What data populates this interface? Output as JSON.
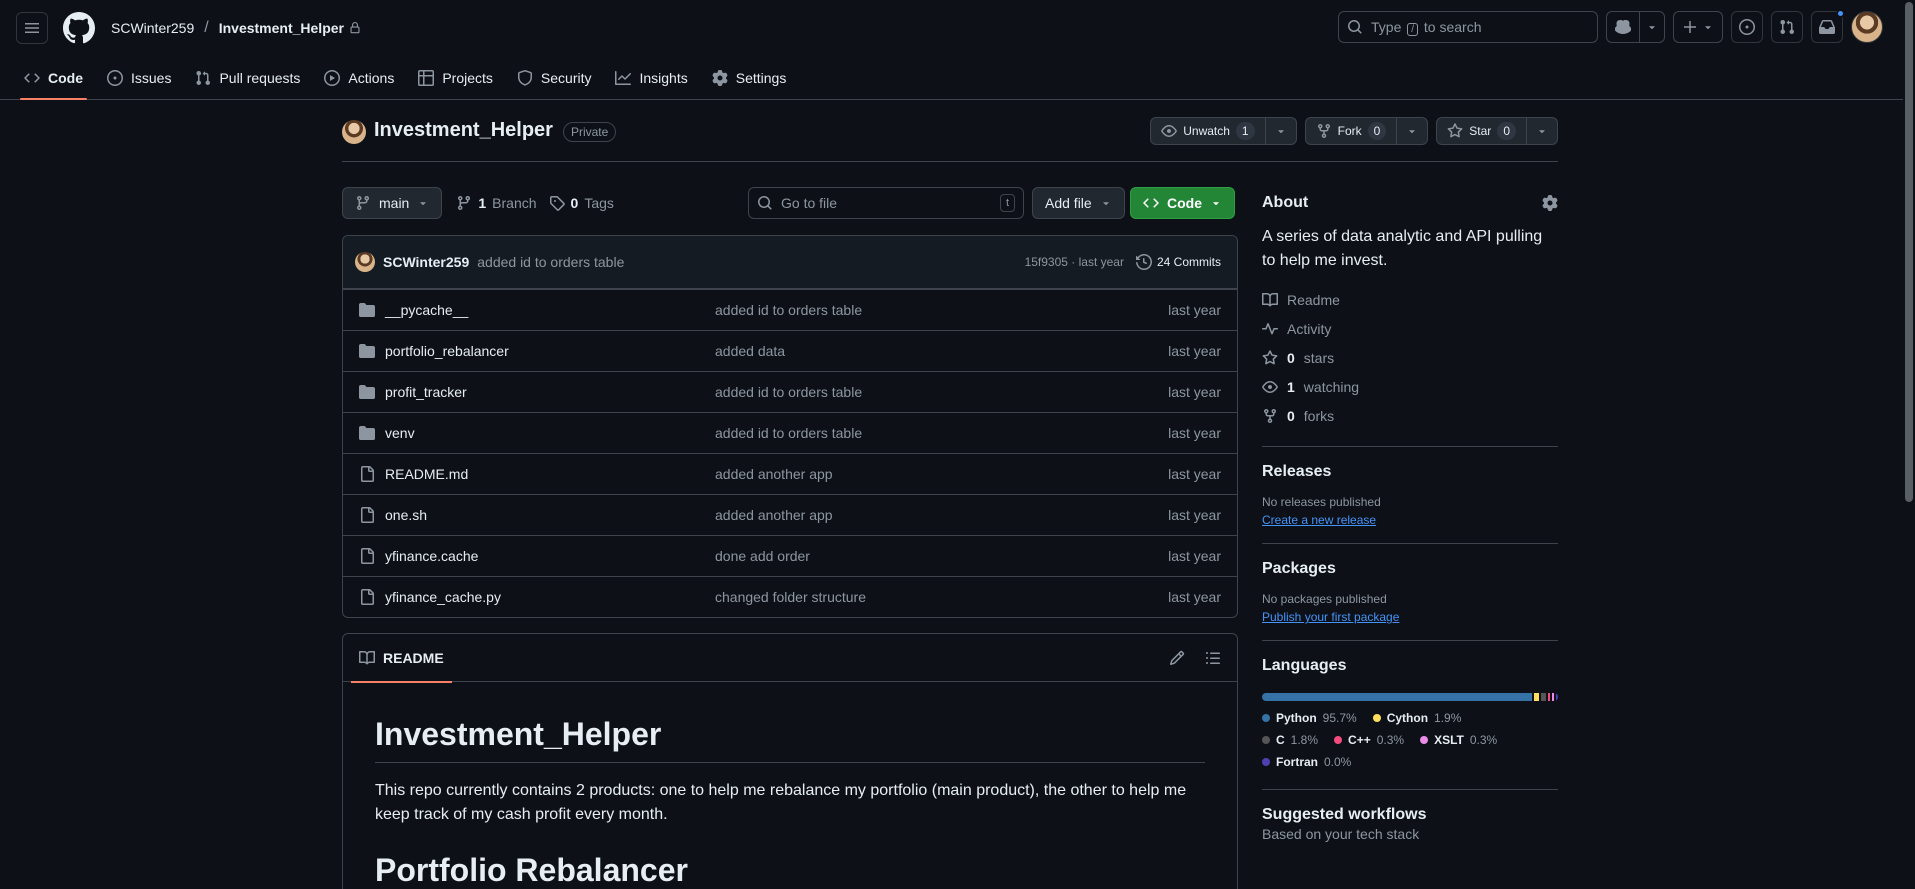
{
  "header": {
    "owner": "SCWinter259",
    "separator": "/",
    "repo": "Investment_Helper",
    "search_placeholder": "Type",
    "search_key": "/",
    "search_suffix": "to search"
  },
  "repo_nav": {
    "tabs": [
      {
        "label": "Code",
        "icon": "code-icon",
        "active": true
      },
      {
        "label": "Issues",
        "icon": "issue-opened-icon"
      },
      {
        "label": "Pull requests",
        "icon": "git-pull-request-icon"
      },
      {
        "label": "Actions",
        "icon": "play-icon"
      },
      {
        "label": "Projects",
        "icon": "table-icon"
      },
      {
        "label": "Security",
        "icon": "shield-icon"
      },
      {
        "label": "Insights",
        "icon": "graph-icon"
      },
      {
        "label": "Settings",
        "icon": "gear-icon"
      }
    ]
  },
  "title": {
    "name": "Investment_Helper",
    "visibility": "Private",
    "unwatch_label": "Unwatch",
    "unwatch_count": "1",
    "fork_label": "Fork",
    "fork_count": "0",
    "star_label": "Star",
    "star_count": "0"
  },
  "toolbar": {
    "branch": "main",
    "branches_count": "1",
    "branches_label": "Branch",
    "tags_count": "0",
    "tags_label": "Tags",
    "goto_placeholder": "Go to file",
    "goto_key": "t",
    "add_file": "Add file",
    "code": "Code"
  },
  "latest_commit": {
    "author": "SCWinter259",
    "message": "added id to orders table",
    "hash_date": "15f9305 · last year",
    "commits_label": "24 Commits"
  },
  "files": [
    {
      "name": "__pycache__",
      "type": "folder",
      "message": "added id to orders table",
      "date": "last year"
    },
    {
      "name": "portfolio_rebalancer",
      "type": "folder",
      "message": "added data",
      "date": "last year"
    },
    {
      "name": "profit_tracker",
      "type": "folder",
      "message": "added id to orders table",
      "date": "last year"
    },
    {
      "name": "venv",
      "type": "folder",
      "message": "added id to orders table",
      "date": "last year"
    },
    {
      "name": "README.md",
      "type": "file",
      "message": "added another app",
      "date": "last year"
    },
    {
      "name": "one.sh",
      "type": "file",
      "message": "added another app",
      "date": "last year"
    },
    {
      "name": "yfinance.cache",
      "type": "file",
      "message": "done add order",
      "date": "last year"
    },
    {
      "name": "yfinance_cache.py",
      "type": "file",
      "message": "changed folder structure",
      "date": "last year"
    }
  ],
  "readme": {
    "tab_label": "README",
    "h1": "Investment_Helper",
    "paragraph": "This repo currently contains 2 products: one to help me rebalance my portfolio (main product), the other to help me keep track of my cash profit every month.",
    "h2": "Portfolio Rebalancer"
  },
  "sidebar": {
    "about_title": "About",
    "description": "A series of data analytic and API pulling to help me invest.",
    "links": [
      {
        "icon": "book-icon",
        "bold": "",
        "label": "Readme"
      },
      {
        "icon": "pulse-icon",
        "bold": "",
        "label": "Activity"
      },
      {
        "icon": "star-icon",
        "bold": "0",
        "label": "stars"
      },
      {
        "icon": "eye-icon",
        "bold": "1",
        "label": "watching"
      },
      {
        "icon": "fork-icon",
        "bold": "0",
        "label": "forks"
      }
    ],
    "releases_title": "Releases",
    "releases_text": "No releases published",
    "releases_link": "Create a new release",
    "packages_title": "Packages",
    "packages_text": "No packages published",
    "packages_link": "Publish your first package",
    "languages_title": "Languages",
    "languages": [
      {
        "name": "Python",
        "pct": "95.7%",
        "value": 95.7,
        "color": "#3572A5"
      },
      {
        "name": "Cython",
        "pct": "1.9%",
        "value": 1.9,
        "color": "#fedf5b"
      },
      {
        "name": "C",
        "pct": "1.8%",
        "value": 1.8,
        "color": "#555555"
      },
      {
        "name": "C++",
        "pct": "0.3%",
        "value": 0.3,
        "color": "#f34b7d"
      },
      {
        "name": "XSLT",
        "pct": "0.3%",
        "value": 0.3,
        "color": "#EB8CEB"
      },
      {
        "name": "Fortran",
        "pct": "0.0%",
        "value": 0.0,
        "color": "#4d41b1"
      }
    ],
    "workflows_title": "Suggested workflows",
    "workflows_sub": "Based on your tech stack"
  }
}
